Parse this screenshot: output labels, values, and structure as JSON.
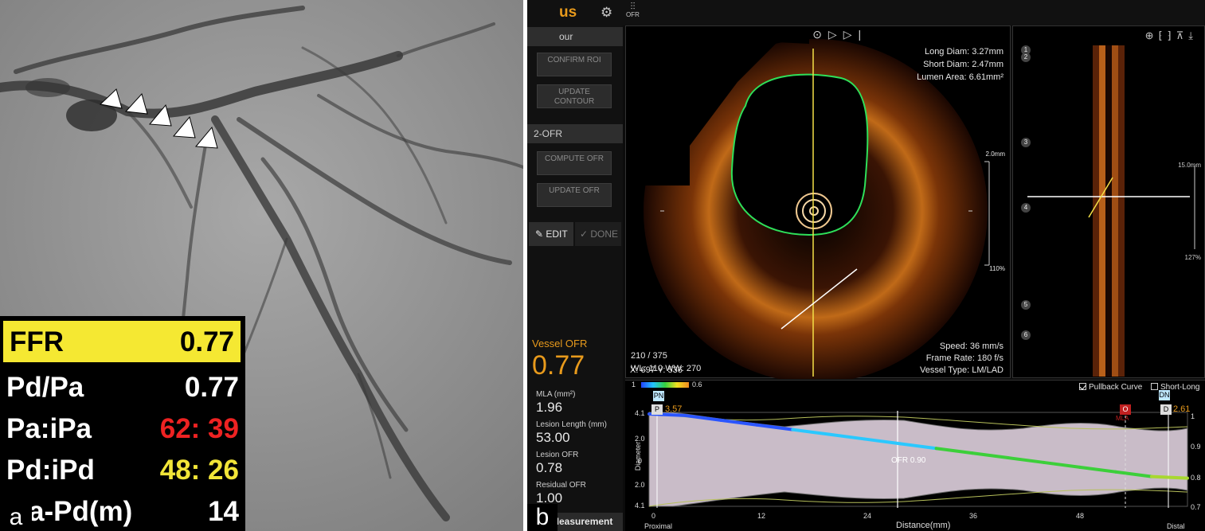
{
  "panel_a": {
    "letter": "a",
    "rows": [
      {
        "label": "FFR",
        "value": "0.77"
      },
      {
        "label": "Pd/Pa",
        "value": "0.77"
      },
      {
        "label": "Pa:iPa",
        "value": "62: 39"
      },
      {
        "label": "Pd:iPd",
        "value": "48: 26"
      },
      {
        "label": "a-Pd(m)",
        "value": "14"
      }
    ],
    "colors": {
      "highlight": "#f5e832",
      "red": "#ee2222",
      "yellow": "#f2e538"
    }
  },
  "panel_b": {
    "letter": "b",
    "brand": "us",
    "toolbar": {
      "ofr_label": "OFR"
    },
    "left": {
      "section1": "our",
      "confirm_roi": "CONFIRM ROI",
      "update_contour": "UPDATE CONTOUR",
      "section2": "2-OFR",
      "compute_ofr": "COMPUTE OFR",
      "update_ofr": "UPDATE OFR",
      "edit": "EDIT",
      "done": "DONE",
      "vessel_ofr_label": "Vessel OFR",
      "vessel_ofr_value": "0.77",
      "metrics": [
        {
          "label": "MLA (mm²)",
          "value": "1.96"
        },
        {
          "label": "Lesion Length (mm)",
          "value": "53.00"
        },
        {
          "label": "Lesion OFR",
          "value": "0.78"
        },
        {
          "label": "Residual OFR",
          "value": "1.00"
        }
      ],
      "measurement": "Measurement"
    },
    "oct": {
      "long_diam": "Long Diam: 3.27mm",
      "short_diam": "Short Diam: 2.47mm",
      "lumen_area": "Lumen Area: 6.61mm²",
      "frame": "210 / 375",
      "wl_ww": "WL: 110  WW: 270",
      "xy": "X: 697  Y: 536",
      "speed": "Speed: 36 mm/s",
      "frame_rate": "Frame Rate: 180 f/s",
      "vessel_type": "Vessel Type: LM/LAD",
      "scale_top": "2.0mm",
      "scale_bottom": "110%"
    },
    "long_view": {
      "markers": [
        "1",
        "2",
        "3",
        "4",
        "5",
        "6"
      ],
      "scale_top": "15.0mm",
      "scale_bottom": "127%"
    },
    "curve": {
      "pullback_label": "Pullback Curve",
      "short_long_label": "Short-Long",
      "colorbar_min": "1",
      "colorbar_max": "0.6",
      "pn_tag": "PN",
      "dn_tag": "DN",
      "p_tag": "P",
      "p_value": "3.57",
      "o_tag": "O",
      "mla_tag": "MLA",
      "d_tag": "D",
      "d_value": "2.61",
      "ofr_annotation": "OFR 0.90",
      "ylabel": "Diameter",
      "xlabel": "Distance(mm)",
      "proximal": "Proximal",
      "distal": "Distal",
      "y_left_ticks": [
        "4.1",
        "2.0",
        "0",
        "2.0",
        "4.1"
      ],
      "y_right_ticks": [
        "1",
        "0.9",
        "0.8",
        "0.7"
      ],
      "x_ticks": [
        "0",
        "12",
        "24",
        "36",
        "48"
      ]
    }
  },
  "chart_data": {
    "type": "line",
    "title": "",
    "xlabel": "Distance(mm)",
    "ylabel": "Diameter",
    "xlim": [
      0,
      60
    ],
    "ylim_right": [
      0.7,
      1.0
    ],
    "grid": false,
    "series": [
      {
        "x": [
          0,
          4,
          8,
          12,
          16,
          20,
          24,
          28,
          32,
          36,
          40,
          44,
          48,
          52,
          56,
          60
        ],
        "y": [
          0.995,
          0.99,
          0.975,
          0.96,
          0.945,
          0.93,
          0.915,
          0.9,
          0.885,
          0.87,
          0.855,
          0.84,
          0.825,
          0.81,
          0.795,
          0.79
        ]
      }
    ],
    "annotations": [
      "3.57",
      "2.61",
      "OFR 0.90",
      "MLA"
    ]
  }
}
